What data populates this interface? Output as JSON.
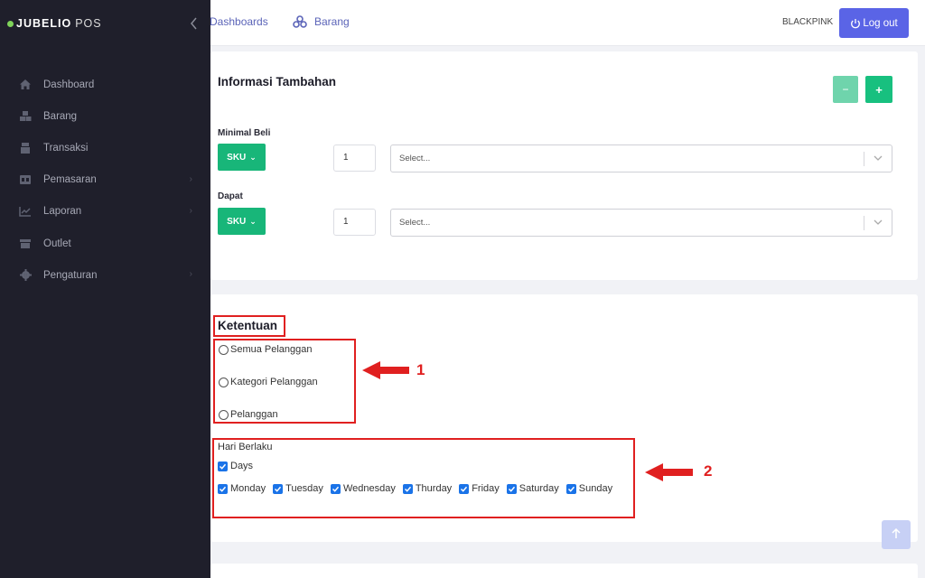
{
  "brand": {
    "name": "JUBELIO",
    "suffix": "POS",
    "dot_color": "#7fd35a"
  },
  "sidebar": {
    "items": [
      {
        "label": "Dashboard",
        "icon": "home-icon",
        "has_children": false
      },
      {
        "label": "Barang",
        "icon": "boxes-icon",
        "has_children": false
      },
      {
        "label": "Transaksi",
        "icon": "cashier-icon",
        "has_children": false
      },
      {
        "label": "Pemasaran",
        "icon": "ad-icon",
        "has_children": true
      },
      {
        "label": "Laporan",
        "icon": "chart-line-icon",
        "has_children": true
      },
      {
        "label": "Outlet",
        "icon": "store-icon",
        "has_children": false
      },
      {
        "label": "Pengaturan",
        "icon": "gear-icon",
        "has_children": true
      }
    ]
  },
  "topbar": {
    "links": [
      {
        "label": "Dashboards",
        "icon": "chevron-left-icon"
      },
      {
        "label": "Barang",
        "icon": "boxes-icon"
      }
    ],
    "user": "BLACKPINK",
    "logout_label": "Log out"
  },
  "info": {
    "title": "Informasi Tambahan",
    "minus_label": "−",
    "plus_label": "+",
    "min_label": "Minimal Beli",
    "get_label": "Dapat",
    "sku_label": "SKU",
    "min_qty": "1",
    "get_qty": "1",
    "select_placeholder": "Select..."
  },
  "ketentuan": {
    "title": "Ketentuan",
    "options": [
      "Semua Pelanggan",
      "Kategori Pelanggan",
      "Pelanggan"
    ],
    "hari_label": "Hari Berlaku",
    "days_label": "Days",
    "days": [
      "Monday",
      "Tuesday",
      "Wednesday",
      "Thurday",
      "Friday",
      "Saturday",
      "Sunday"
    ]
  },
  "annotations": {
    "one": "1",
    "two": "2",
    "color": "#e02020"
  },
  "colors": {
    "sidebar_bg": "#1f1f2b",
    "primary": "#5a64e6",
    "green": "#18b679",
    "checkbox": "#1a73e8"
  }
}
